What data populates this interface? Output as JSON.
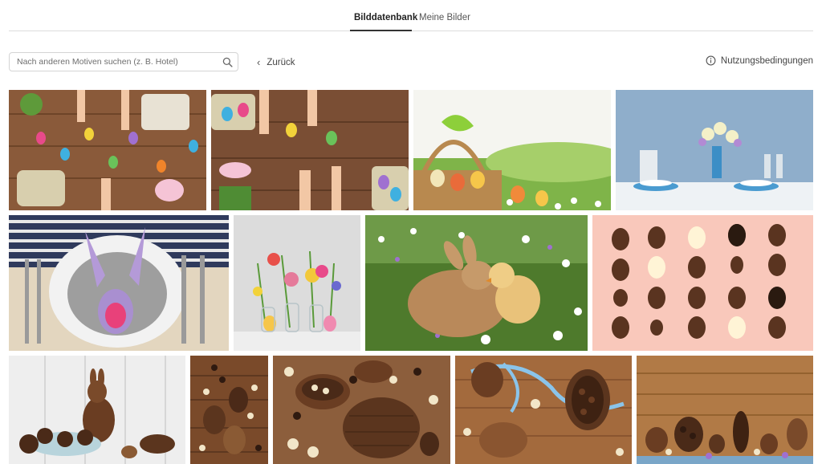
{
  "tabs": [
    {
      "label": "Bilddatenbank",
      "active": true
    },
    {
      "label": "Meine Bilder",
      "active": false
    }
  ],
  "search": {
    "placeholder": "Nach anderen Motiven suchen (z. B. Hotel)",
    "value": "",
    "icon": "search-icon"
  },
  "nav": {
    "back_label": "Zurück",
    "back_icon": "chevron-left-icon"
  },
  "terms": {
    "label": "Nutzungsbedingungen",
    "icon": "info-icon"
  },
  "gallery": {
    "images": [
      {
        "subject": "easter-eggs-painting-table",
        "colors": [
          "#8a5a3a",
          "#c9794b"
        ]
      },
      {
        "subject": "easter-eggs-painting-hands",
        "colors": [
          "#7a4e34",
          "#d18a55"
        ]
      },
      {
        "subject": "easter-basket-green-bow",
        "colors": [
          "#f2f2ec",
          "#8dbf4a"
        ]
      },
      {
        "subject": "easter-table-setting-blue",
        "colors": [
          "#8aa9c6",
          "#e9eef3"
        ]
      },
      {
        "subject": "bunny-napkin-plate",
        "colors": [
          "#c8c8c4",
          "#a98fd0"
        ]
      },
      {
        "subject": "flowers-eggs-vases",
        "colors": [
          "#dcdcdc",
          "#e57a9a"
        ]
      },
      {
        "subject": "rabbit-and-chick",
        "colors": [
          "#4e7a2c",
          "#b9895a"
        ]
      },
      {
        "subject": "chocolate-bunnies-pink",
        "colors": [
          "#f9c8bb",
          "#5a3420"
        ]
      },
      {
        "subject": "chocolate-bunny-white-wood",
        "colors": [
          "#eeeeee",
          "#6a3d22"
        ]
      },
      {
        "subject": "chocolate-eggs-wood-top",
        "colors": [
          "#7a4a2a",
          "#4b2a18"
        ]
      },
      {
        "subject": "chocolate-egg-cracked",
        "colors": [
          "#8c5e3c",
          "#5b351e"
        ]
      },
      {
        "subject": "chocolate-ribbon-eggs",
        "colors": [
          "#a36a3d",
          "#6bb3e0"
        ]
      },
      {
        "subject": "chocolate-bunnies-wood-board",
        "colors": [
          "#b17a46",
          "#4a2a18"
        ]
      }
    ]
  }
}
